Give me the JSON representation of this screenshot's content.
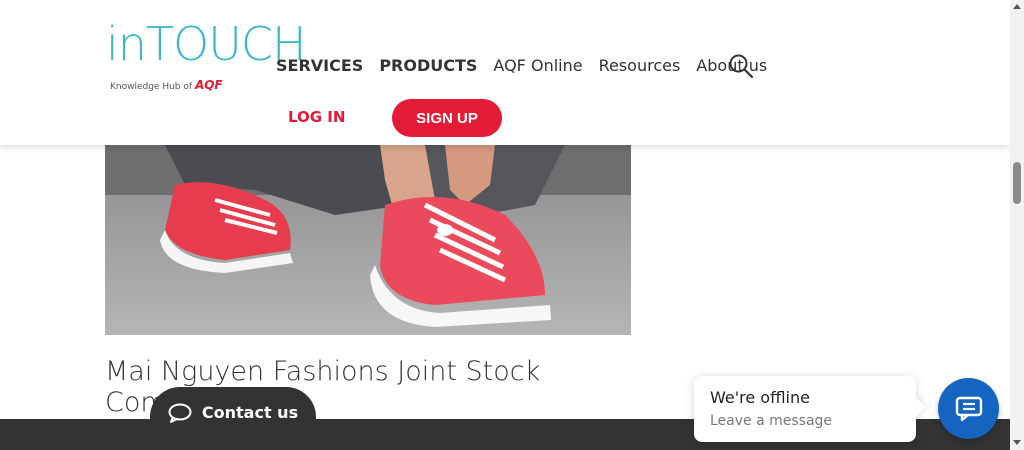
{
  "logo": {
    "wordmark": "inTOUCH",
    "tagline": "Knowledge Hub of",
    "brand": "AQF"
  },
  "nav": {
    "items": [
      {
        "label": "SERVICES"
      },
      {
        "label": "PRODUCTS"
      },
      {
        "label": "AQF Online"
      },
      {
        "label": "Resources"
      },
      {
        "label": "About us"
      }
    ]
  },
  "auth": {
    "login_label": "LOG IN",
    "signup_label": "SIGN UP"
  },
  "article": {
    "company_title": "Mai Nguyen Fashions Joint Stock Company"
  },
  "contact": {
    "label": "Contact us"
  },
  "chat": {
    "status": "We're offline",
    "prompt": "Leave a message"
  },
  "colors": {
    "accent_red": "#e31b37",
    "logo_teal": "#3cb9c6",
    "chat_blue": "#1565c0",
    "footer_dark": "#333333"
  }
}
